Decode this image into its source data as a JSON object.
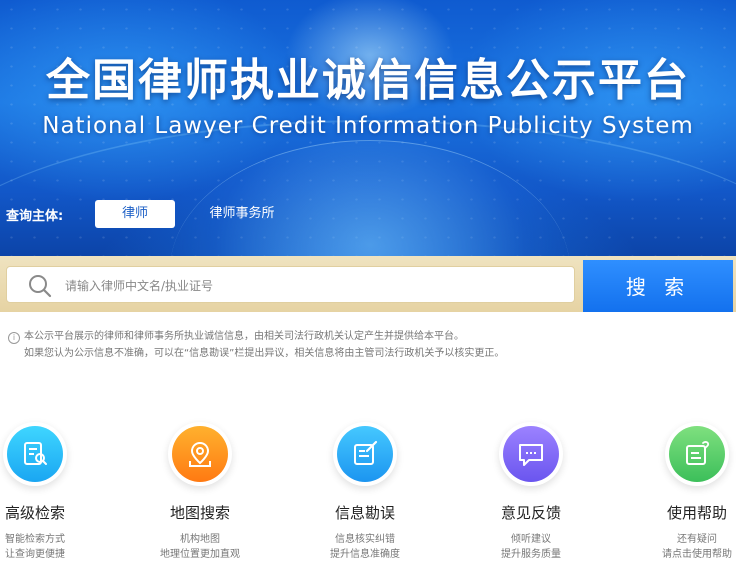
{
  "header": {
    "title_cn": "全国律师执业诚信信息公示平台",
    "title_en": "National Lawyer Credit Information Publicity System"
  },
  "query": {
    "label": "查询主体:",
    "tabs": [
      {
        "label": "律师",
        "active": true
      },
      {
        "label": "律师事务所",
        "active": false
      }
    ]
  },
  "search": {
    "placeholder": "请输入律师中文名/执业证号",
    "value": "",
    "button_label": "搜 索"
  },
  "notice": {
    "line1": "本公示平台展示的律师和律师事务所执业诚信信息，由相关司法行政机关认定产生并提供给本平台。",
    "line2": "如果您认为公示信息不准确，可以在“信息勘误”栏提出异议，相关信息将由主管司法行政机关予以核实更正。"
  },
  "features": [
    {
      "icon": "advanced-search-icon",
      "title": "高级检索",
      "desc1": "智能检索方式",
      "desc2": "让查询更便捷",
      "color_from": "#3fd6ff",
      "color_to": "#1aa6f2"
    },
    {
      "icon": "map-pin-icon",
      "title": "地图搜索",
      "desc1": "机构地图",
      "desc2": "地理位置更加直观",
      "color_from": "#ffb12e",
      "color_to": "#ff7a12"
    },
    {
      "icon": "edit-document-icon",
      "title": "信息勘误",
      "desc1": "信息核实纠错",
      "desc2": "提升信息准确度",
      "color_from": "#45c8ff",
      "color_to": "#1c95f0"
    },
    {
      "icon": "feedback-chat-icon",
      "title": "意见反馈",
      "desc1": "倾听建议",
      "desc2": "提升服务质量",
      "color_from": "#9c82ff",
      "color_to": "#6a55ef"
    },
    {
      "icon": "help-document-icon",
      "title": "使用帮助",
      "desc1": "还有疑问",
      "desc2": "请点击使用帮助",
      "color_from": "#7fe07f",
      "color_to": "#3cbf5a"
    }
  ]
}
